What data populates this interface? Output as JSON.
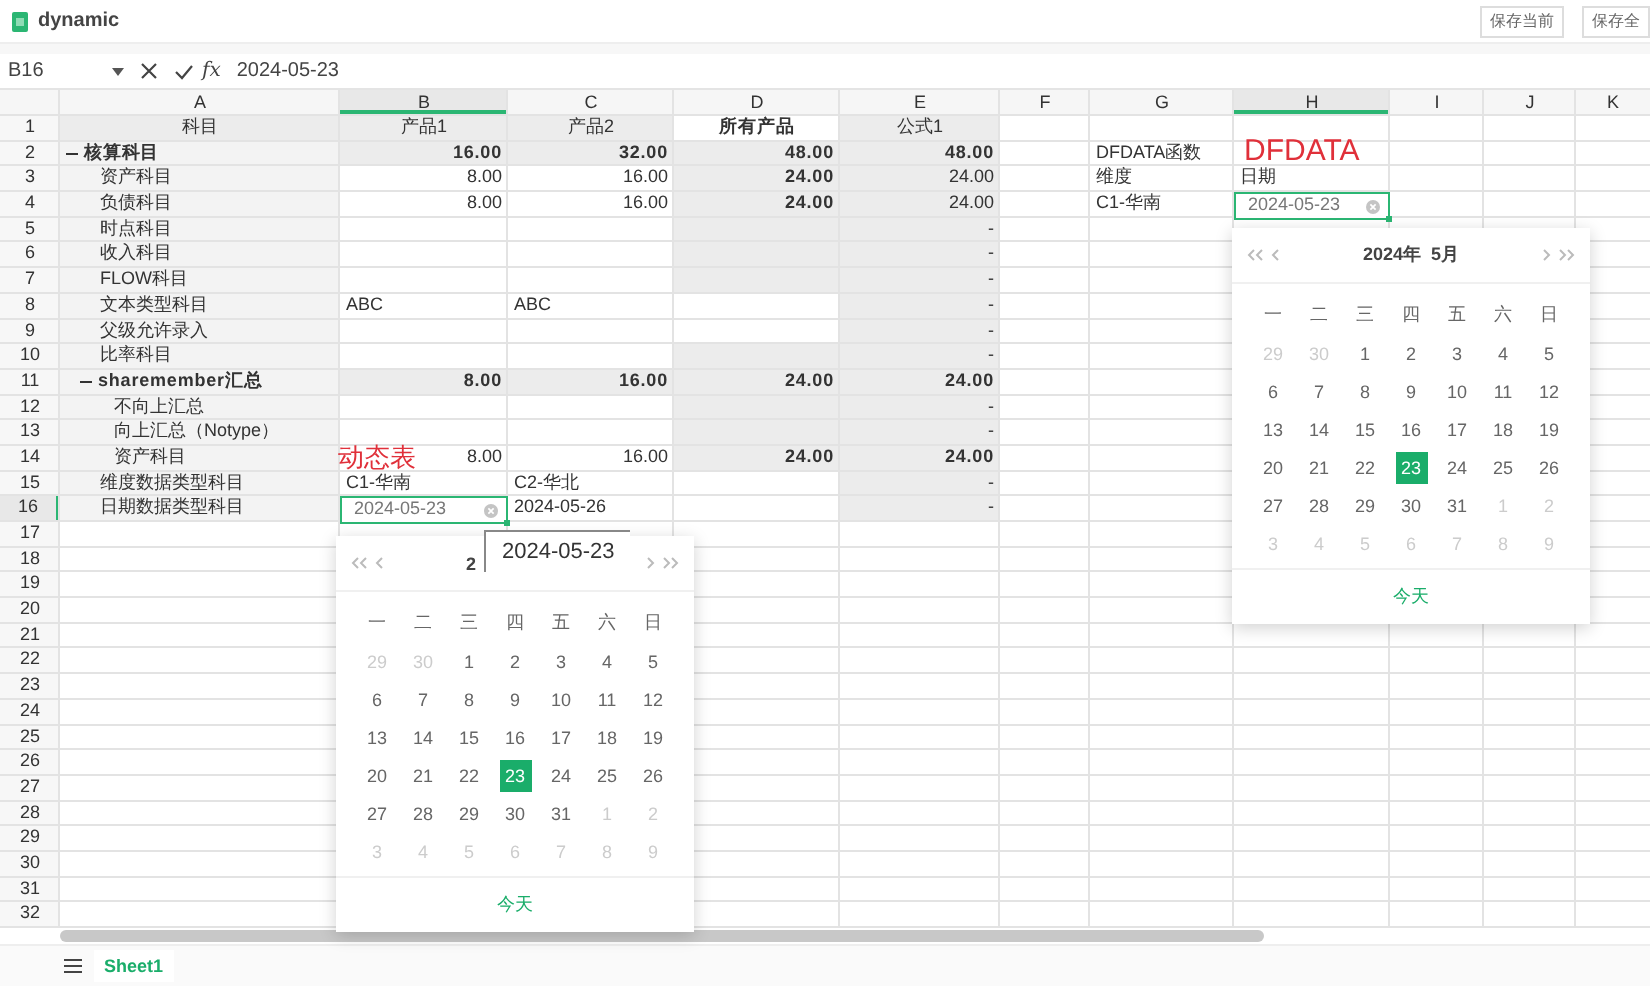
{
  "window": {
    "title": "dynamic",
    "buttons": [
      "保存当前",
      "保存全"
    ]
  },
  "formula_bar": {
    "cell_ref": "B16",
    "function_label": "fx",
    "value": "2024-05-23"
  },
  "columns": [
    {
      "label": "A",
      "selected": false
    },
    {
      "label": "B",
      "selected": true
    },
    {
      "label": "C",
      "selected": false
    },
    {
      "label": "D",
      "selected": false
    },
    {
      "label": "E",
      "selected": false
    },
    {
      "label": "F",
      "selected": false
    },
    {
      "label": "G",
      "selected": false
    },
    {
      "label": "H",
      "selected": true
    },
    {
      "label": "I",
      "selected": false
    },
    {
      "label": "J",
      "selected": false
    },
    {
      "label": "K",
      "selected": false
    }
  ],
  "header_row": {
    "number": "1",
    "selected": false,
    "cells": [
      {
        "text": "科目",
        "kind": "heading",
        "shaded": true
      },
      {
        "text": "产品1",
        "kind": "heading",
        "shaded": true
      },
      {
        "text": "产品2",
        "kind": "heading",
        "shaded": true
      },
      {
        "text": "所有产品",
        "kind": "heading",
        "bold": true,
        "shaded": false
      },
      {
        "text": "公式1",
        "kind": "heading",
        "shaded": true
      }
    ]
  },
  "tree": [
    {
      "number": "2",
      "label": "核算科目",
      "expanded": true,
      "selected": false,
      "cells": [
        {
          "text": "16.00",
          "kind": "number",
          "bold": true,
          "shaded": true
        },
        {
          "text": "32.00",
          "kind": "number",
          "bold": true,
          "shaded": true
        },
        {
          "text": "48.00",
          "kind": "number",
          "bold": true,
          "shaded": true
        },
        {
          "text": "48.00",
          "kind": "number",
          "bold": true,
          "shaded": true
        },
        {
          "shaded": false
        },
        {
          "text": "DFDATA函数",
          "kind": "text",
          "shaded": false
        }
      ],
      "children": [
        {
          "number": "3",
          "label": "资产科目",
          "selected": false,
          "cells": [
            {
              "text": "8.00",
              "kind": "number",
              "shaded": false
            },
            {
              "text": "16.00",
              "kind": "number",
              "shaded": false
            },
            {
              "text": "24.00",
              "kind": "number",
              "bold": true,
              "shaded": true
            },
            {
              "text": "24.00",
              "kind": "number",
              "shaded": true
            },
            {
              "shaded": false
            },
            {
              "text": "维度",
              "kind": "text",
              "shaded": false
            },
            {
              "text": "日期",
              "kind": "text",
              "shaded": false
            }
          ]
        },
        {
          "number": "4",
          "label": "负债科目",
          "selected": false,
          "cells": [
            {
              "text": "8.00",
              "kind": "number",
              "shaded": false
            },
            {
              "text": "16.00",
              "kind": "number",
              "shaded": false
            },
            {
              "text": "24.00",
              "kind": "number",
              "bold": true,
              "shaded": true
            },
            {
              "text": "24.00",
              "kind": "number",
              "shaded": true
            },
            {
              "shaded": false
            },
            {
              "text": "C1-华南",
              "kind": "text",
              "shaded": false
            },
            {
              "text": "2024-05-23",
              "kind": "date_editor",
              "shaded": false
            }
          ]
        },
        {
          "number": "5",
          "label": "时点科目",
          "selected": false,
          "cells": [
            {
              "shaded": false
            },
            {
              "shaded": false
            },
            {
              "shaded": true
            },
            {
              "text": "-",
              "kind": "number",
              "shaded": true
            }
          ]
        },
        {
          "number": "6",
          "label": "收入科目",
          "selected": false,
          "cells": [
            {
              "shaded": false
            },
            {
              "shaded": false
            },
            {
              "shaded": true
            },
            {
              "text": "-",
              "kind": "number",
              "shaded": true
            }
          ]
        },
        {
          "number": "7",
          "label": "FLOW科目",
          "selected": false,
          "cells": [
            {
              "shaded": false
            },
            {
              "shaded": false
            },
            {
              "shaded": true
            },
            {
              "text": "-",
              "kind": "number",
              "shaded": true
            }
          ]
        },
        {
          "number": "8",
          "label": "文本类型科目",
          "selected": false,
          "cells": [
            {
              "text": "ABC",
              "kind": "text",
              "shaded": false
            },
            {
              "text": "ABC",
              "kind": "text",
              "shaded": false
            },
            {
              "shaded": false
            },
            {
              "text": "-",
              "kind": "number",
              "shaded": true
            }
          ]
        },
        {
          "number": "9",
          "label": "父级允许录入",
          "selected": false,
          "cells": [
            {
              "shaded": false
            },
            {
              "shaded": false
            },
            {
              "shaded": false
            },
            {
              "text": "-",
              "kind": "number",
              "shaded": true
            }
          ]
        },
        {
          "number": "10",
          "label": "比率科目",
          "selected": false,
          "cells": [
            {
              "shaded": false
            },
            {
              "shaded": false
            },
            {
              "shaded": true
            },
            {
              "text": "-",
              "kind": "number",
              "shaded": true
            }
          ]
        },
        {
          "number": "11",
          "label": "sharemember汇总",
          "expanded": true,
          "selected": false,
          "cells": [
            {
              "text": "8.00",
              "kind": "number",
              "bold": true,
              "shaded": true
            },
            {
              "text": "16.00",
              "kind": "number",
              "bold": true,
              "shaded": true
            },
            {
              "text": "24.00",
              "kind": "number",
              "bold": true,
              "shaded": true
            },
            {
              "text": "24.00",
              "kind": "number",
              "bold": true,
              "shaded": true
            }
          ],
          "children": [
            {
              "number": "12",
              "label": "不向上汇总",
              "selected": false,
              "cells": [
                {
                  "shaded": false
                },
                {
                  "shaded": false
                },
                {
                  "shaded": true
                },
                {
                  "text": "-",
                  "kind": "number",
                  "shaded": true
                }
              ]
            },
            {
              "number": "13",
              "label": "向上汇总（Notype）",
              "selected": false,
              "cells": [
                {
                  "shaded": false
                },
                {
                  "shaded": false
                },
                {
                  "shaded": true
                },
                {
                  "text": "-",
                  "kind": "number",
                  "shaded": true
                }
              ]
            },
            {
              "number": "14",
              "label": "资产科目",
              "selected": false,
              "cells": [
                {
                  "text": "8.00",
                  "kind": "number",
                  "shaded": false
                },
                {
                  "text": "16.00",
                  "kind": "number",
                  "shaded": false
                },
                {
                  "text": "24.00",
                  "kind": "number",
                  "bold": true,
                  "shaded": true
                },
                {
                  "text": "24.00",
                  "kind": "number",
                  "bold": true,
                  "shaded": true
                }
              ]
            }
          ]
        },
        {
          "number": "15",
          "label": "维度数据类型科目",
          "selected": false,
          "cells": [
            {
              "text": "C1-华南",
              "kind": "text",
              "shaded": false
            },
            {
              "text": "C2-华北",
              "kind": "text",
              "shaded": false
            },
            {
              "shaded": false
            },
            {
              "text": "-",
              "kind": "number",
              "shaded": true
            }
          ]
        },
        {
          "number": "16",
          "label": "日期数据类型科目",
          "selected": true,
          "cells": [
            {
              "text": "2024-05-23",
              "kind": "date_editor",
              "shaded": false
            },
            {
              "text": "2024-05-26",
              "kind": "text",
              "shaded": false
            },
            {
              "shaded": false
            },
            {
              "text": "-",
              "kind": "number",
              "shaded": true
            }
          ]
        }
      ]
    }
  ],
  "empty_rows": [
    {
      "number": "17",
      "selected": false
    },
    {
      "number": "18",
      "selected": false
    },
    {
      "number": "19",
      "selected": false
    },
    {
      "number": "20",
      "selected": false
    },
    {
      "number": "21",
      "selected": false
    },
    {
      "number": "22",
      "selected": false
    },
    {
      "number": "23",
      "selected": false
    },
    {
      "number": "24",
      "selected": false
    },
    {
      "number": "25",
      "selected": false
    },
    {
      "number": "26",
      "selected": false
    },
    {
      "number": "27",
      "selected": false
    },
    {
      "number": "28",
      "selected": false
    },
    {
      "number": "29",
      "selected": false
    },
    {
      "number": "30",
      "selected": false
    },
    {
      "number": "31",
      "selected": false
    },
    {
      "number": "32",
      "selected": false
    }
  ],
  "annotations": [
    {
      "text": "DFDATA"
    },
    {
      "text": "动态表"
    }
  ],
  "tooltip": {
    "text": "2024-05-23"
  },
  "calendars": [
    {
      "title": "2",
      "weekdays": [
        "一",
        "二",
        "三",
        "四",
        "五",
        "六",
        "日"
      ],
      "today_button": "今天",
      "days": [
        {
          "text": "29",
          "muted": true,
          "selected": false
        },
        {
          "text": "30",
          "muted": true,
          "selected": false
        },
        {
          "text": "1",
          "muted": false,
          "selected": false
        },
        {
          "text": "2",
          "muted": false,
          "selected": false
        },
        {
          "text": "3",
          "muted": false,
          "selected": false
        },
        {
          "text": "4",
          "muted": false,
          "selected": false
        },
        {
          "text": "5",
          "muted": false,
          "selected": false
        },
        {
          "text": "6",
          "muted": false,
          "selected": false
        },
        {
          "text": "7",
          "muted": false,
          "selected": false
        },
        {
          "text": "8",
          "muted": false,
          "selected": false
        },
        {
          "text": "9",
          "muted": false,
          "selected": false
        },
        {
          "text": "10",
          "muted": false,
          "selected": false
        },
        {
          "text": "11",
          "muted": false,
          "selected": false
        },
        {
          "text": "12",
          "muted": false,
          "selected": false
        },
        {
          "text": "13",
          "muted": false,
          "selected": false
        },
        {
          "text": "14",
          "muted": false,
          "selected": false
        },
        {
          "text": "15",
          "muted": false,
          "selected": false
        },
        {
          "text": "16",
          "muted": false,
          "selected": false
        },
        {
          "text": "17",
          "muted": false,
          "selected": false
        },
        {
          "text": "18",
          "muted": false,
          "selected": false
        },
        {
          "text": "19",
          "muted": false,
          "selected": false
        },
        {
          "text": "20",
          "muted": false,
          "selected": false
        },
        {
          "text": "21",
          "muted": false,
          "selected": false
        },
        {
          "text": "22",
          "muted": false,
          "selected": false
        },
        {
          "text": "23",
          "muted": false,
          "selected": true
        },
        {
          "text": "24",
          "muted": false,
          "selected": false
        },
        {
          "text": "25",
          "muted": false,
          "selected": false
        },
        {
          "text": "26",
          "muted": false,
          "selected": false
        },
        {
          "text": "27",
          "muted": false,
          "selected": false
        },
        {
          "text": "28",
          "muted": false,
          "selected": false
        },
        {
          "text": "29",
          "muted": false,
          "selected": false
        },
        {
          "text": "30",
          "muted": false,
          "selected": false
        },
        {
          "text": "31",
          "muted": false,
          "selected": false
        },
        {
          "text": "1",
          "muted": true,
          "selected": false
        },
        {
          "text": "2",
          "muted": true,
          "selected": false
        },
        {
          "text": "3",
          "muted": true,
          "selected": false
        },
        {
          "text": "4",
          "muted": true,
          "selected": false
        },
        {
          "text": "5",
          "muted": true,
          "selected": false
        },
        {
          "text": "6",
          "muted": true,
          "selected": false
        },
        {
          "text": "7",
          "muted": true,
          "selected": false
        },
        {
          "text": "8",
          "muted": true,
          "selected": false
        },
        {
          "text": "9",
          "muted": true,
          "selected": false
        }
      ]
    },
    {
      "title": "2024年  5月",
      "weekdays": [
        "一",
        "二",
        "三",
        "四",
        "五",
        "六",
        "日"
      ],
      "today_button": "今天",
      "days": [
        {
          "text": "29",
          "muted": true,
          "selected": false
        },
        {
          "text": "30",
          "muted": true,
          "selected": false
        },
        {
          "text": "1",
          "muted": false,
          "selected": false
        },
        {
          "text": "2",
          "muted": false,
          "selected": false
        },
        {
          "text": "3",
          "muted": false,
          "selected": false
        },
        {
          "text": "4",
          "muted": false,
          "selected": false
        },
        {
          "text": "5",
          "muted": false,
          "selected": false
        },
        {
          "text": "6",
          "muted": false,
          "selected": false
        },
        {
          "text": "7",
          "muted": false,
          "selected": false
        },
        {
          "text": "8",
          "muted": false,
          "selected": false
        },
        {
          "text": "9",
          "muted": false,
          "selected": false
        },
        {
          "text": "10",
          "muted": false,
          "selected": false
        },
        {
          "text": "11",
          "muted": false,
          "selected": false
        },
        {
          "text": "12",
          "muted": false,
          "selected": false
        },
        {
          "text": "13",
          "muted": false,
          "selected": false
        },
        {
          "text": "14",
          "muted": false,
          "selected": false
        },
        {
          "text": "15",
          "muted": false,
          "selected": false
        },
        {
          "text": "16",
          "muted": false,
          "selected": false
        },
        {
          "text": "17",
          "muted": false,
          "selected": false
        },
        {
          "text": "18",
          "muted": false,
          "selected": false
        },
        {
          "text": "19",
          "muted": false,
          "selected": false
        },
        {
          "text": "20",
          "muted": false,
          "selected": false
        },
        {
          "text": "21",
          "muted": false,
          "selected": false
        },
        {
          "text": "22",
          "muted": false,
          "selected": false
        },
        {
          "text": "23",
          "muted": false,
          "selected": true
        },
        {
          "text": "24",
          "muted": false,
          "selected": false
        },
        {
          "text": "25",
          "muted": false,
          "selected": false
        },
        {
          "text": "26",
          "muted": false,
          "selected": false
        },
        {
          "text": "27",
          "muted": false,
          "selected": false
        },
        {
          "text": "28",
          "muted": false,
          "selected": false
        },
        {
          "text": "29",
          "muted": false,
          "selected": false
        },
        {
          "text": "30",
          "muted": false,
          "selected": false
        },
        {
          "text": "31",
          "muted": false,
          "selected": false
        },
        {
          "text": "1",
          "muted": true,
          "selected": false
        },
        {
          "text": "2",
          "muted": true,
          "selected": false
        },
        {
          "text": "3",
          "muted": true,
          "selected": false
        },
        {
          "text": "4",
          "muted": true,
          "selected": false
        },
        {
          "text": "5",
          "muted": true,
          "selected": false
        },
        {
          "text": "6",
          "muted": true,
          "selected": false
        },
        {
          "text": "7",
          "muted": true,
          "selected": false
        },
        {
          "text": "8",
          "muted": true,
          "selected": false
        },
        {
          "text": "9",
          "muted": true,
          "selected": false
        }
      ]
    }
  ],
  "sheet_tabs": [
    {
      "label": "Sheet1",
      "selected": true
    }
  ]
}
